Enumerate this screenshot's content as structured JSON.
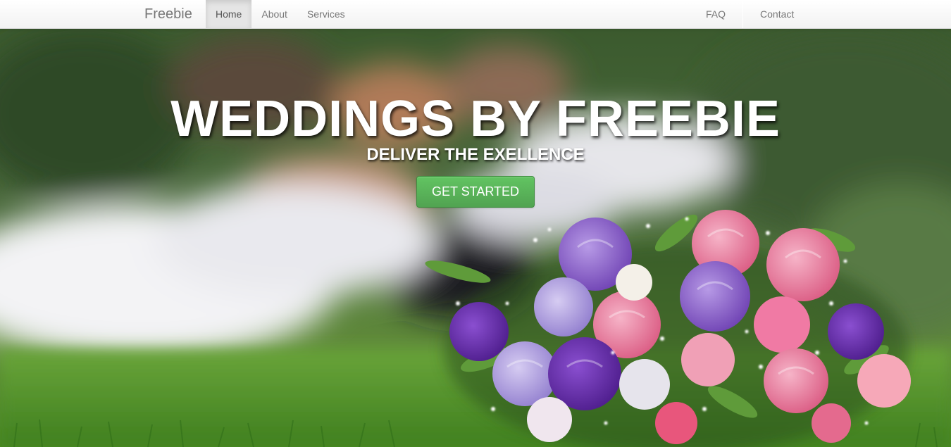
{
  "nav": {
    "brand": "Freebie",
    "left_items": [
      {
        "label": "Home",
        "active": true
      },
      {
        "label": "About",
        "active": false
      },
      {
        "label": "Services",
        "active": false
      }
    ],
    "right_items": [
      {
        "label": "FAQ"
      },
      {
        "label": "Contact"
      }
    ]
  },
  "hero": {
    "title": "WEDDINGS BY FREEBIE",
    "subtitle": "DELIVER THE EXELLENCE",
    "cta_label": "GET STARTED"
  },
  "colors": {
    "cta": "#5bb75b",
    "grass": "#4e8f2a",
    "nav_text": "#777777"
  }
}
